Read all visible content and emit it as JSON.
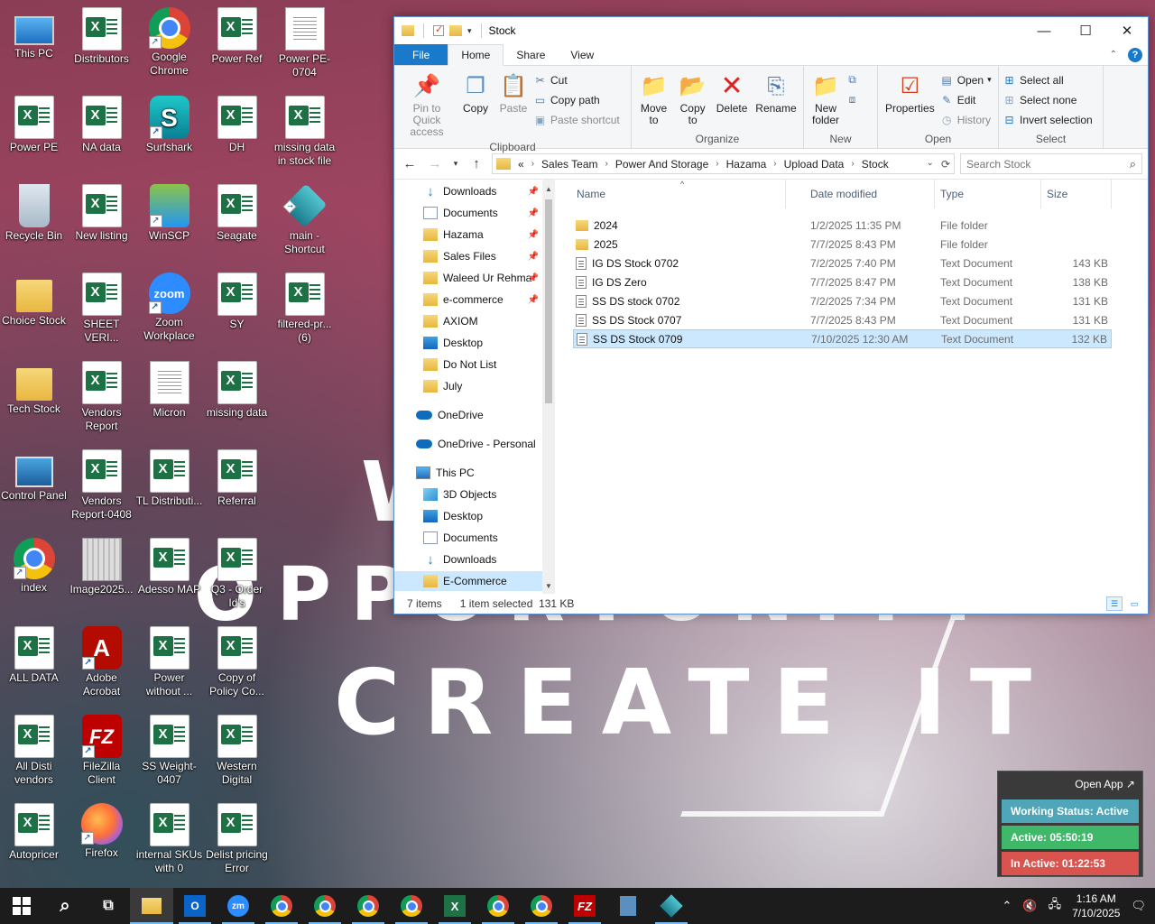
{
  "wallpaper": {
    "line1": "W",
    "line2": "OPPORTUNITY",
    "line3": "CREATE IT"
  },
  "desktop_icons": [
    {
      "label": "This PC",
      "icon": "pc"
    },
    {
      "label": "Distributors",
      "icon": "excel"
    },
    {
      "label": "Google Chrome",
      "icon": "chrome"
    },
    {
      "label": "Power Ref",
      "icon": "excel"
    },
    {
      "label": "Power PE-0704",
      "icon": "doc"
    },
    {
      "label": "Power PE",
      "icon": "excel"
    },
    {
      "label": "NA data",
      "icon": "excel"
    },
    {
      "label": "Surfshark",
      "icon": "surfshark"
    },
    {
      "label": "DH",
      "icon": "excel"
    },
    {
      "label": "missing data in stock file",
      "icon": "excel"
    },
    {
      "label": "Recycle Bin",
      "icon": "recycle-bin"
    },
    {
      "label": "New listing",
      "icon": "excel"
    },
    {
      "label": "WinSCP",
      "icon": "winscp"
    },
    {
      "label": "Seagate",
      "icon": "excel"
    },
    {
      "label": "main - Shortcut",
      "icon": "app"
    },
    {
      "label": "Choice Stock",
      "icon": "folder"
    },
    {
      "label": "SHEET VERI...",
      "icon": "excel"
    },
    {
      "label": "Zoom Workplace",
      "icon": "zoom"
    },
    {
      "label": "SY",
      "icon": "excel"
    },
    {
      "label": "filtered-pr... (6)",
      "icon": "excel"
    },
    {
      "label": "Tech Stock",
      "icon": "folder"
    },
    {
      "label": "Vendors Report",
      "icon": "excel"
    },
    {
      "label": "Micron",
      "icon": "doc"
    },
    {
      "label": "missing data",
      "icon": "excel"
    },
    {
      "label": "Control Panel",
      "icon": "control-panel"
    },
    {
      "label": "Vendors Report-0408",
      "icon": "excel"
    },
    {
      "label": "TL Distributi...",
      "icon": "excel"
    },
    {
      "label": "Referral",
      "icon": "excel"
    },
    {
      "label": "index",
      "icon": "chrome"
    },
    {
      "label": "Image2025...",
      "icon": "image"
    },
    {
      "label": "Adesso MAP",
      "icon": "excel"
    },
    {
      "label": "Q3 - Order Id's",
      "icon": "excel"
    },
    {
      "label": "ALL DATA",
      "icon": "excel"
    },
    {
      "label": "Adobe Acrobat",
      "icon": "acrobat"
    },
    {
      "label": "Power without ...",
      "icon": "excel"
    },
    {
      "label": "Copy of Policy Co...",
      "icon": "excel"
    },
    {
      "label": "All Disti vendors",
      "icon": "excel"
    },
    {
      "label": "FileZilla Client",
      "icon": "filezilla"
    },
    {
      "label": "SS Weight-0407",
      "icon": "excel"
    },
    {
      "label": "Western Digital",
      "icon": "excel"
    },
    {
      "label": "Autopricer",
      "icon": "excel"
    },
    {
      "label": "Firefox",
      "icon": "firefox"
    },
    {
      "label": "internal SKUs with 0",
      "icon": "excel"
    },
    {
      "label": "Delist pricing Error",
      "icon": "excel"
    }
  ],
  "explorer": {
    "title": "Stock",
    "controls": {
      "minimize": "—",
      "maximize": "☐",
      "close": "✕"
    },
    "tabs": {
      "file": "File",
      "home": "Home",
      "share": "Share",
      "view": "View"
    },
    "ribbon": {
      "clipboard": {
        "label": "Clipboard",
        "pin": "Pin to Quick access",
        "copy": "Copy",
        "paste": "Paste",
        "cut": "Cut",
        "copy_path": "Copy path",
        "paste_shortcut": "Paste shortcut"
      },
      "organize": {
        "label": "Organize",
        "move_to": "Move to",
        "copy_to": "Copy to",
        "delete": "Delete",
        "rename": "Rename"
      },
      "new": {
        "label": "New",
        "new_folder": "New folder"
      },
      "open": {
        "label": "Open",
        "properties": "Properties",
        "open": "Open",
        "edit": "Edit",
        "history": "History"
      },
      "select": {
        "label": "Select",
        "select_all": "Select all",
        "select_none": "Select none",
        "invert": "Invert selection"
      }
    },
    "address": {
      "prefix": "«",
      "crumbs": [
        "Sales Team",
        "Power And Storage",
        "Hazama",
        "Upload Data",
        "Stock"
      ]
    },
    "search_placeholder": "Search Stock",
    "nav": [
      {
        "label": "Downloads",
        "icon": "download",
        "pinned": true
      },
      {
        "label": "Documents",
        "icon": "documents",
        "pinned": true
      },
      {
        "label": "Hazama",
        "icon": "folder",
        "pinned": true
      },
      {
        "label": "Sales Files",
        "icon": "folder",
        "pinned": true
      },
      {
        "label": "Waleed Ur Rehma",
        "icon": "folder",
        "pinned": true
      },
      {
        "label": "e-commerce",
        "icon": "folder",
        "pinned": true
      },
      {
        "label": "AXIOM",
        "icon": "folder",
        "pinned": false
      },
      {
        "label": "Desktop",
        "icon": "desktop",
        "pinned": false
      },
      {
        "label": "Do Not List",
        "icon": "folder",
        "pinned": false
      },
      {
        "label": "July",
        "icon": "folder",
        "pinned": false
      },
      {
        "label": "OneDrive",
        "icon": "cloud",
        "pinned": false
      },
      {
        "label": "OneDrive - Personal",
        "icon": "cloud",
        "pinned": false
      },
      {
        "label": "This PC",
        "icon": "pc",
        "pinned": false
      },
      {
        "label": "3D Objects",
        "icon": "3d",
        "pinned": false
      },
      {
        "label": "Desktop",
        "icon": "desktop",
        "pinned": false
      },
      {
        "label": "Documents",
        "icon": "documents",
        "pinned": false
      },
      {
        "label": "Downloads",
        "icon": "download",
        "pinned": false
      },
      {
        "label": "E-Commerce",
        "icon": "folder",
        "pinned": false
      }
    ],
    "columns": {
      "name": "Name",
      "date": "Date modified",
      "type": "Type",
      "size": "Size"
    },
    "files": [
      {
        "name": "2024",
        "date": "1/2/2025 11:35 PM",
        "type": "File folder",
        "size": "",
        "kind": "folder"
      },
      {
        "name": "2025",
        "date": "7/7/2025 8:43 PM",
        "type": "File folder",
        "size": "",
        "kind": "folder"
      },
      {
        "name": "IG DS Stock 0702",
        "date": "7/2/2025 7:40 PM",
        "type": "Text Document",
        "size": "143 KB",
        "kind": "txt"
      },
      {
        "name": "IG DS Zero",
        "date": "7/7/2025 8:47 PM",
        "type": "Text Document",
        "size": "138 KB",
        "kind": "txt"
      },
      {
        "name": "SS DS stock 0702",
        "date": "7/2/2025 7:34 PM",
        "type": "Text Document",
        "size": "131 KB",
        "kind": "txt"
      },
      {
        "name": "SS DS Stock 0707",
        "date": "7/7/2025 8:43 PM",
        "type": "Text Document",
        "size": "131 KB",
        "kind": "txt"
      },
      {
        "name": "SS DS Stock 0709",
        "date": "7/10/2025 12:30 AM",
        "type": "Text Document",
        "size": "132 KB",
        "kind": "txt",
        "selected": true
      }
    ],
    "status": {
      "count": "7 items",
      "selection": "1 item selected  131 KB"
    }
  },
  "tracker": {
    "open_app": "Open App ↗",
    "status": "Working Status: Active",
    "active": "Active: 05:50:19",
    "inactive": "In Active: 01:22:53"
  },
  "taskbar": {
    "time": "1:16 AM",
    "date": "7/10/2025"
  }
}
